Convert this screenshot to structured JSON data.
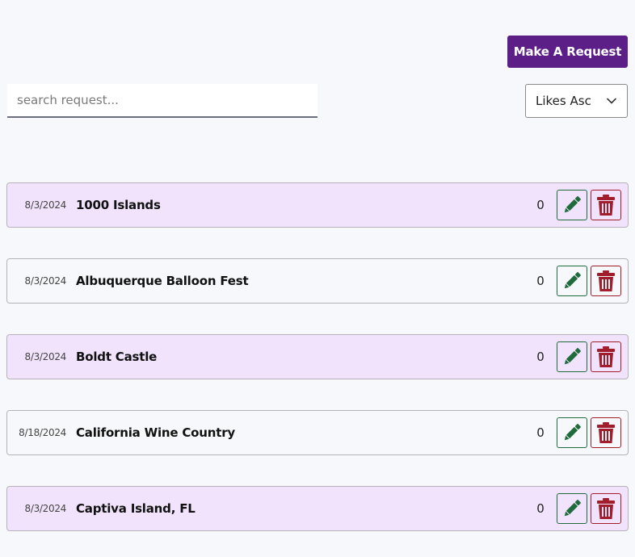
{
  "header": {
    "make_request_label": "Make A Request"
  },
  "search": {
    "placeholder": "search request...",
    "value": ""
  },
  "sort": {
    "selected": "Likes Asc"
  },
  "colors": {
    "primary": "#5b1f87",
    "row_alt": "#f1e3fb",
    "edit": "#1f6b3c",
    "delete": "#a11d2b"
  },
  "icons": {
    "edit": "pencil-icon",
    "delete": "trash-icon",
    "sort": "chevron-down-icon"
  },
  "requests": [
    {
      "date": "8/3/2024",
      "title": "1000 Islands",
      "likes": "0"
    },
    {
      "date": "8/3/2024",
      "title": "Albuquerque Balloon Fest",
      "likes": "0"
    },
    {
      "date": "8/3/2024",
      "title": "Boldt Castle",
      "likes": "0"
    },
    {
      "date": "8/18/2024",
      "title": "California Wine Country",
      "likes": "0"
    },
    {
      "date": "8/3/2024",
      "title": "Captiva Island, FL",
      "likes": "0"
    }
  ]
}
